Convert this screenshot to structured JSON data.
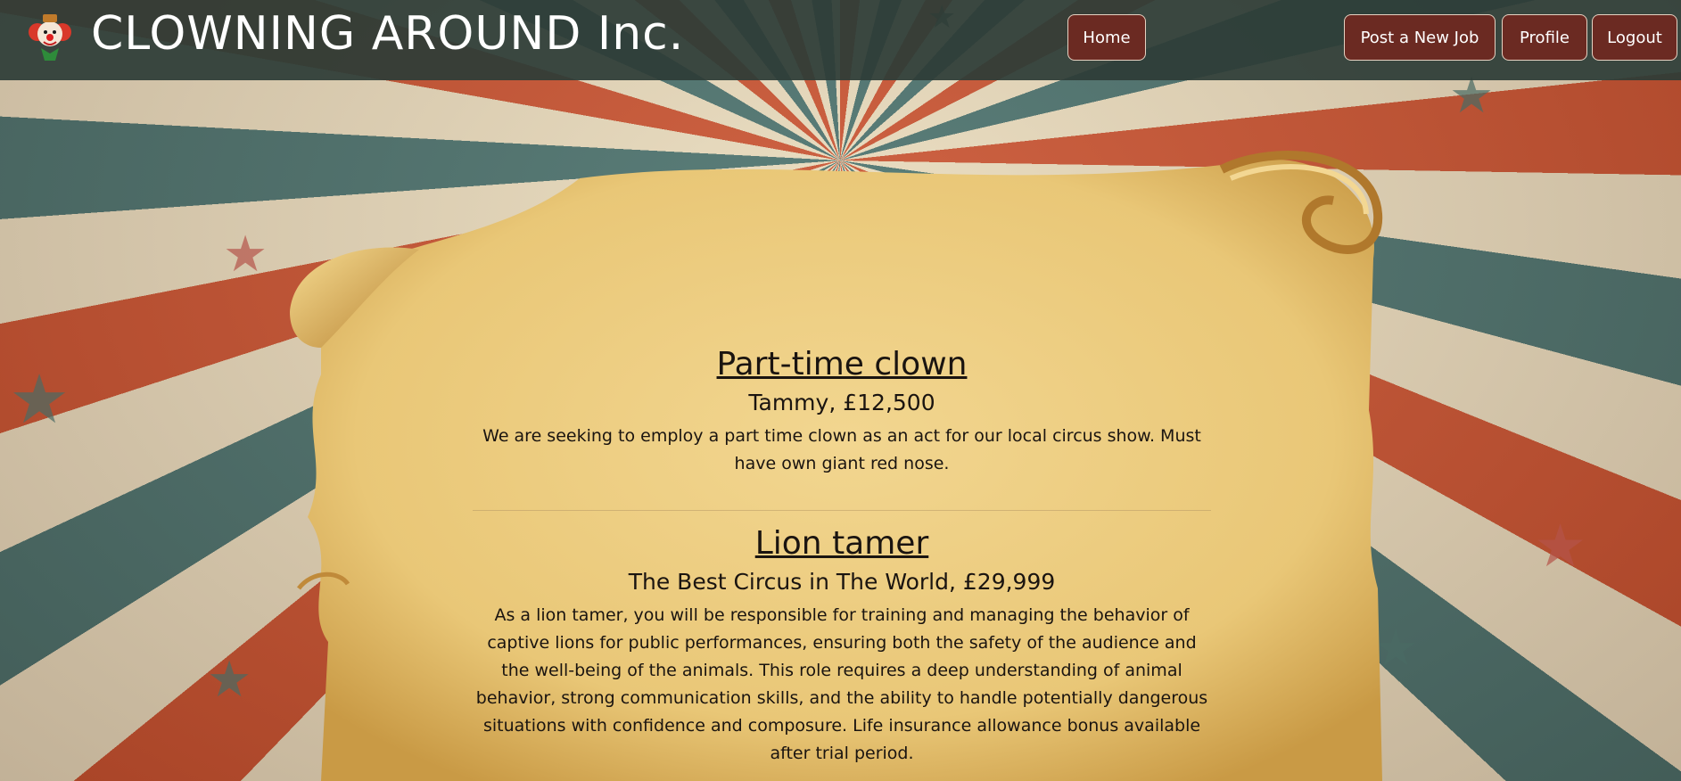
{
  "site": {
    "title": "CLOWNING AROUND Inc.",
    "logo_icon": "clown-face-icon"
  },
  "nav": {
    "items": [
      {
        "label": "Home"
      },
      {
        "label": "Post a New Job"
      },
      {
        "label": "Profile"
      },
      {
        "label": "Logout"
      }
    ]
  },
  "jobs": [
    {
      "title": "Part-time clown",
      "meta": "Tammy, £12,500",
      "description": "We are seeking to employ a part time clown as an act for our local circus show. Must have own giant red nose."
    },
    {
      "title": "Lion tamer",
      "meta": "The Best Circus in The World, £29,999",
      "description": "As a lion tamer, you will be responsible for training and managing the behavior of captive lions for public performances, ensuring both the safety of the audience and the well-being of the animals. This role requires a deep understanding of animal behavior, strong communication skills, and the ability to handle potentially dangerous situations with confidence and composure. Life insurance allowance bonus available after trial period."
    }
  ],
  "colors": {
    "header_bg": "#2d3c37",
    "button_bg": "#6b2a22",
    "parchment": "#eed08a",
    "stripe_red": "#c64a2a",
    "stripe_teal": "#3e6b6b"
  }
}
